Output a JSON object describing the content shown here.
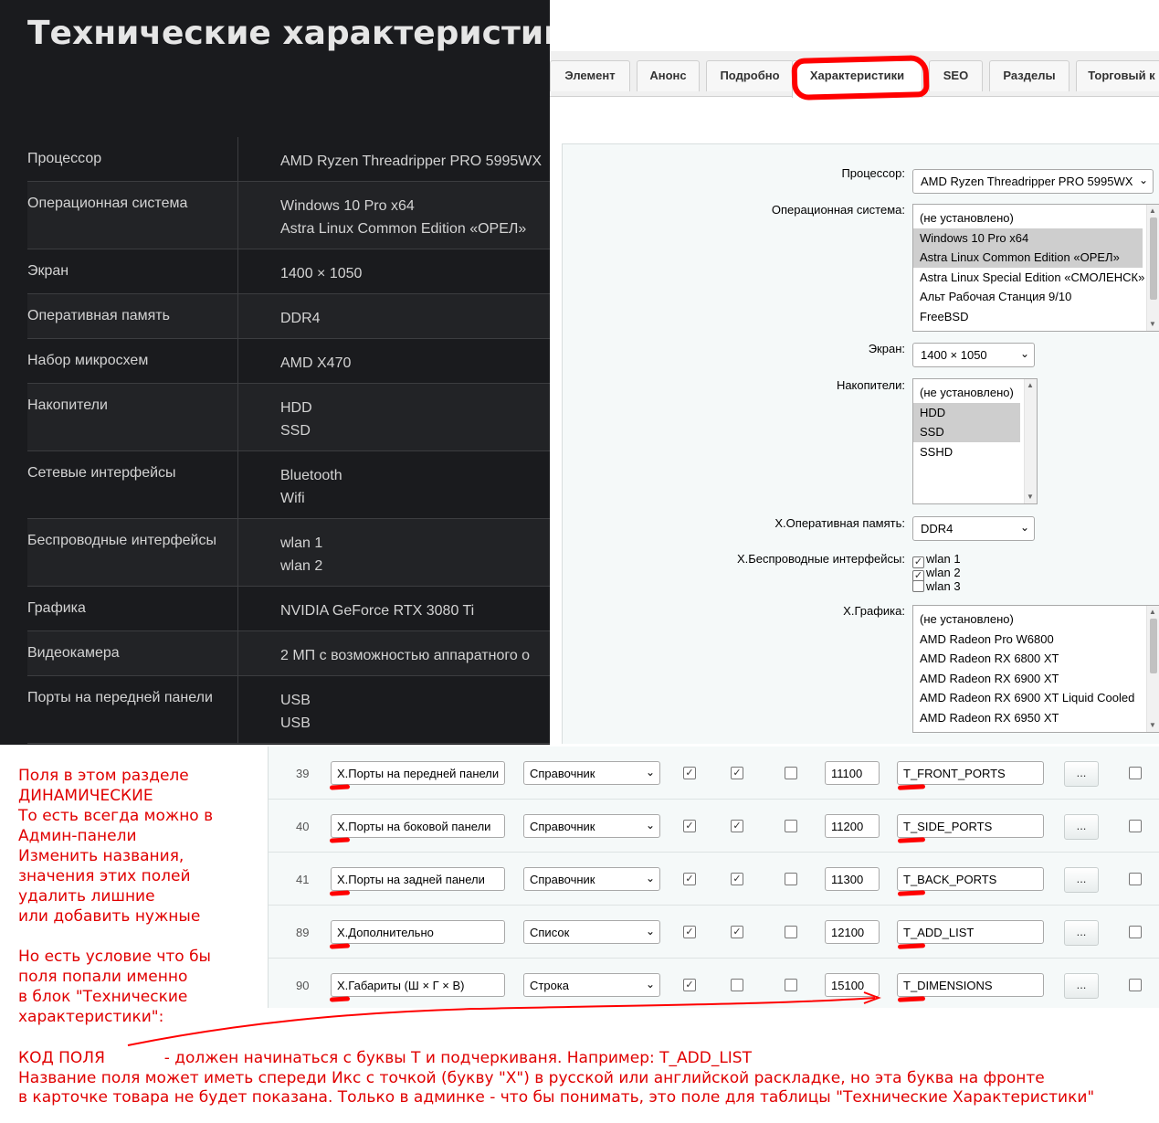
{
  "spec": {
    "title": "Технические характеристики",
    "rows": [
      {
        "name": "Процессор",
        "values": [
          "AMD Ryzen Threadripper PRO 5995WX"
        ]
      },
      {
        "name": "Операционная система",
        "values": [
          "Windows 10 Pro x64",
          "Astra Linux Common Edition «ОРЕЛ»"
        ]
      },
      {
        "name": "Экран",
        "values": [
          "1400 × 1050"
        ]
      },
      {
        "name": "Оперативная память",
        "values": [
          "DDR4"
        ]
      },
      {
        "name": "Набор микросхем",
        "values": [
          "AMD X470"
        ]
      },
      {
        "name": "Накопители",
        "values": [
          "HDD",
          "SSD"
        ]
      },
      {
        "name": "Сетевые интерфейсы",
        "values": [
          "Bluetooth",
          "Wifi"
        ]
      },
      {
        "name": "Беспроводные интерфейсы",
        "values": [
          "wlan 1",
          "wlan 2"
        ]
      },
      {
        "name": "Графика",
        "values": [
          "NVIDIA GeForce RTX 3080 Ti"
        ]
      },
      {
        "name": "Видеокамера",
        "values": [
          "2 МП с возможностью аппаратного о"
        ]
      },
      {
        "name": "Порты на передней панели",
        "values": [
          "USB",
          "USB"
        ]
      }
    ]
  },
  "tabs": [
    "Элемент",
    "Анонс",
    "Подробно",
    "Характеристики",
    "SEO",
    "Разделы",
    "Торговый к"
  ],
  "active_tab": "Характеристики",
  "form": {
    "processor": {
      "label": "Процессор:",
      "value": "AMD Ryzen Threadripper PRO 5995WX"
    },
    "os": {
      "label": "Операционная система:",
      "options": [
        {
          "text": "(не установлено)",
          "selected": false
        },
        {
          "text": "Windows 10 Pro x64",
          "selected": true
        },
        {
          "text": "Astra Linux Common Edition «ОРЕЛ»",
          "selected": true
        },
        {
          "text": "Astra Linux Special Edition «СМОЛЕНСК»",
          "selected": false
        },
        {
          "text": "Альт Рабочая Станция 9/10",
          "selected": false
        },
        {
          "text": "FreeBSD",
          "selected": false
        }
      ]
    },
    "screen": {
      "label": "Экран:",
      "value": "1400 × 1050"
    },
    "storage": {
      "label": "Накопители:",
      "options": [
        {
          "text": "(не установлено)",
          "selected": false
        },
        {
          "text": "HDD",
          "selected": true
        },
        {
          "text": "SSD",
          "selected": true
        },
        {
          "text": "SSHD",
          "selected": false
        }
      ]
    },
    "ram": {
      "label": "X.Оперативная память:",
      "value": "DDR4"
    },
    "wireless": {
      "label": "X.Беспроводные интерфейсы:",
      "items": [
        {
          "text": "wlan 1",
          "checked": true
        },
        {
          "text": "wlan 2",
          "checked": true
        },
        {
          "text": "wlan 3",
          "checked": false
        }
      ]
    },
    "graphics": {
      "label": "X.Графика:",
      "options": [
        {
          "text": "(не установлено)",
          "selected": false
        },
        {
          "text": "AMD Radeon Pro W6800",
          "selected": false
        },
        {
          "text": "AMD Radeon RX 6800 XT",
          "selected": false
        },
        {
          "text": "AMD Radeon RX 6900 XT",
          "selected": false
        },
        {
          "text": "AMD Radeon RX 6900 XT Liquid Cooled",
          "selected": false
        },
        {
          "text": "AMD Radeon RX 6950 XT",
          "selected": false
        }
      ]
    }
  },
  "fields": [
    {
      "id": "39",
      "name": "X.Порты на передней панели",
      "type": "Справочник",
      "c1": true,
      "c2": true,
      "c3": false,
      "sort": "11100",
      "code": "T_FRONT_PORTS",
      "c4": false
    },
    {
      "id": "40",
      "name": "X.Порты на боковой панели",
      "type": "Справочник",
      "c1": true,
      "c2": true,
      "c3": false,
      "sort": "11200",
      "code": "T_SIDE_PORTS",
      "c4": false
    },
    {
      "id": "41",
      "name": "X.Порты на задней панели",
      "type": "Справочник",
      "c1": true,
      "c2": true,
      "c3": false,
      "sort": "11300",
      "code": "T_BACK_PORTS",
      "c4": false
    },
    {
      "id": "89",
      "name": "X.Дополнительно",
      "type": "Список",
      "c1": true,
      "c2": true,
      "c3": false,
      "sort": "12100",
      "code": "T_ADD_LIST",
      "c4": false
    },
    {
      "id": "90",
      "name": "X.Габариты (Ш × Г × В)",
      "type": "Строка",
      "c1": true,
      "c2": false,
      "c3": false,
      "sort": "15100",
      "code": "T_DIMENSIONS",
      "c4": false
    }
  ],
  "fields_more_label": "...",
  "annotation": {
    "block1": [
      "Поля в этом разделе",
      "ДИНАМИЧЕСКИЕ",
      "То есть всегда можно в",
      "Админ-панели",
      "Изменить названия,",
      "значения этих полей",
      "удалить лишние",
      "или добавить нужные"
    ],
    "block2": [
      "Но есть условие что бы",
      "поля попали именно",
      "в блок \"Технические",
      "характеристики\":"
    ],
    "bottom": [
      "КОД ПОЛЯ            - должен начинаться с буквы Т и подчеркиваня. Например: T_ADD_LIST",
      "Название поля может иметь спереди Икс с точкой (букву \"X\") в русской или английской раскладке, но эта буква на фронте",
      "в карточке товара не будет показана. Только в админке - что бы понимать, это поле для таблицы \"Технические Характеристики\""
    ]
  },
  "colors": {
    "annotation": "#e00000",
    "dark_bg": "#1a1b1e",
    "panel_bg": "#f5f9f9",
    "selected_option": "#cecece"
  }
}
